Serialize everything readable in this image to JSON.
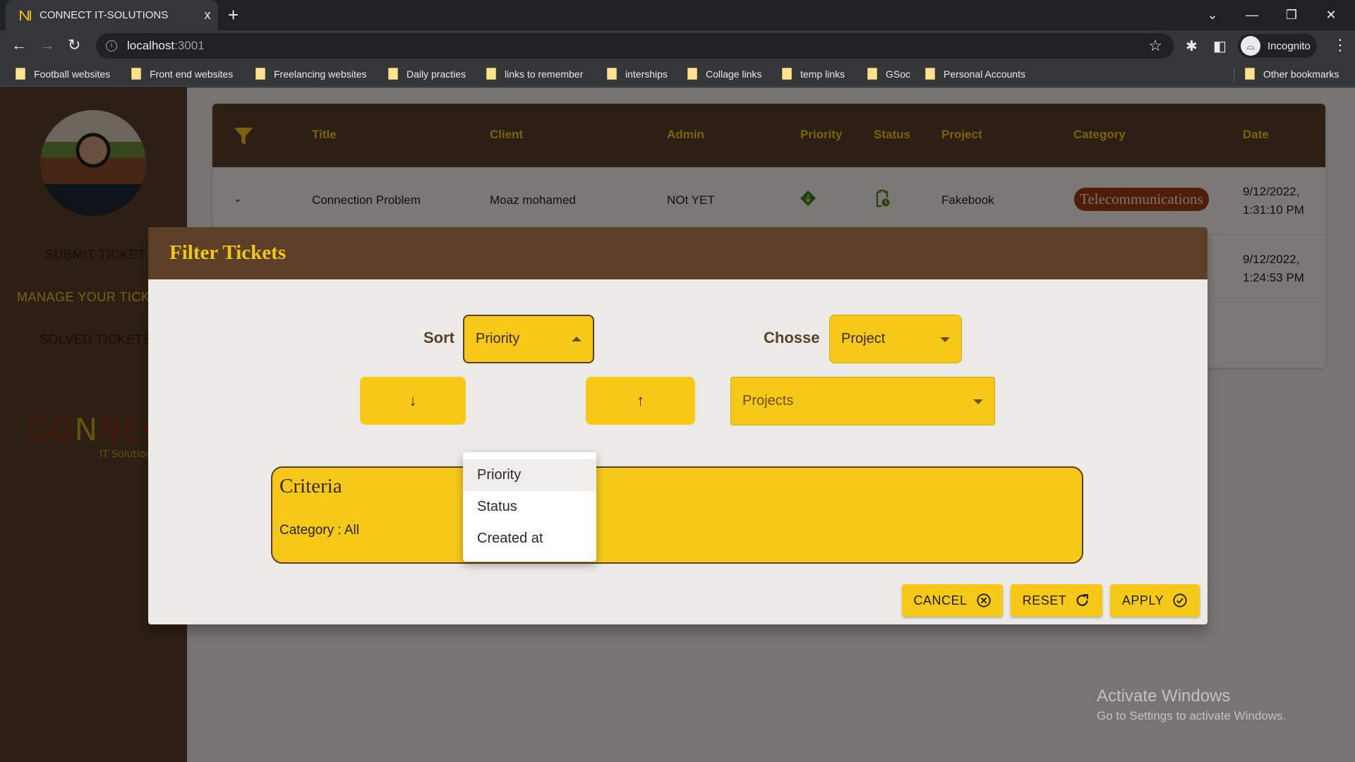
{
  "browser": {
    "tab_title": "CONNECT IT-SOLUTIONS",
    "tab_close": "x",
    "new_tab": "+",
    "url_host": "localhost",
    "url_port": ":3001",
    "profile_label": "Incognito",
    "bookmarks": [
      "Football websites",
      "Front end websites",
      "Freelancing websites",
      "Daily practies",
      "links to remember",
      "interships",
      "Collage links",
      "temp links",
      "GSoc",
      "Personal Accounts"
    ],
    "other_bookmarks": "Other bookmarks"
  },
  "sidebar": {
    "items": [
      {
        "label": "SUBMIT TICKET",
        "active": false
      },
      {
        "label": "MANAGE YOUR TICKETS",
        "active": true
      },
      {
        "label": "SOLVED TICKETS",
        "active": false
      }
    ],
    "logo_word_a": "CO",
    "logo_word_n": "N",
    "logo_word_b": "NECT",
    "logo_sub": "IT Solutions"
  },
  "table": {
    "headers": [
      "Title",
      "Client",
      "Admin",
      "Priority",
      "Status",
      "Project",
      "Category",
      "Date"
    ],
    "rows": [
      {
        "title": "Connection Problem",
        "client": "Moaz mohamed",
        "admin": "NOt YET",
        "priority_icon": "low-priority-icon",
        "status_icon": "pending-clipboard-icon",
        "project": "Fakebook",
        "category": "Telecommunications",
        "date_line1": "9/12/2022,",
        "date_line2": "1:31:10 PM"
      },
      {
        "date_line1": "9/12/2022,",
        "date_line2": "1:24:53 PM"
      }
    ]
  },
  "modal": {
    "title": "Filter Tickets",
    "sort_label": "Sort",
    "sort_value": "Priority",
    "sort_options": [
      "Priority",
      "Status",
      "Created at"
    ],
    "sort_selected_index": 0,
    "desc_icon": "↓",
    "asc_icon": "↑",
    "choose_label": "Chosse",
    "choose_value": "Project",
    "projects_placeholder": "Projects",
    "criteria_title": "Criteria",
    "criteria_line": "Category : All",
    "buttons": {
      "cancel": "CANCEL",
      "reset": "RESET",
      "apply": "APPLY"
    }
  },
  "watermark": {
    "line1": "Activate Windows",
    "line2": "Go to Settings to activate Windows."
  },
  "colors": {
    "brand_brown": "#5b3f27",
    "brand_yellow": "#f6c918",
    "category_pill": "#9e3a12",
    "priority_green": "#2e7d32"
  }
}
